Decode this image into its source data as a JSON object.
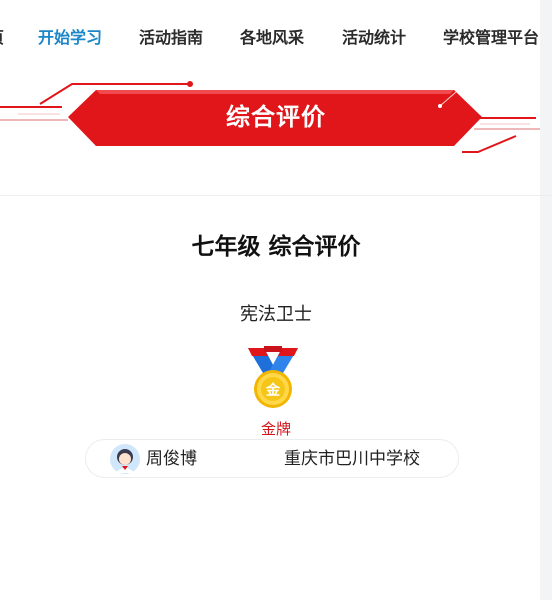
{
  "nav": {
    "items": [
      {
        "label": "首页",
        "active": false
      },
      {
        "label": "开始学习",
        "active": true
      },
      {
        "label": "活动指南",
        "active": false
      },
      {
        "label": "各地风采",
        "active": false
      },
      {
        "label": "活动统计",
        "active": false
      },
      {
        "label": "学校管理平台",
        "active": false
      }
    ]
  },
  "banner": {
    "title": "综合评价"
  },
  "evaluation": {
    "grade_title": "七年级 综合评价",
    "award_name": "宪法卫士",
    "medal_icon": "gold-medal-icon",
    "medal_glyph": "金",
    "medal_label": "金牌"
  },
  "student": {
    "avatar_icon": "student-avatar-icon",
    "name": "周俊博",
    "school": "重庆市巴川中学校"
  },
  "colors": {
    "accent_blue": "#1b87c8",
    "banner_red": "#e0161b",
    "medal_label_red": "#d2161b",
    "gold": "#f5c518"
  }
}
